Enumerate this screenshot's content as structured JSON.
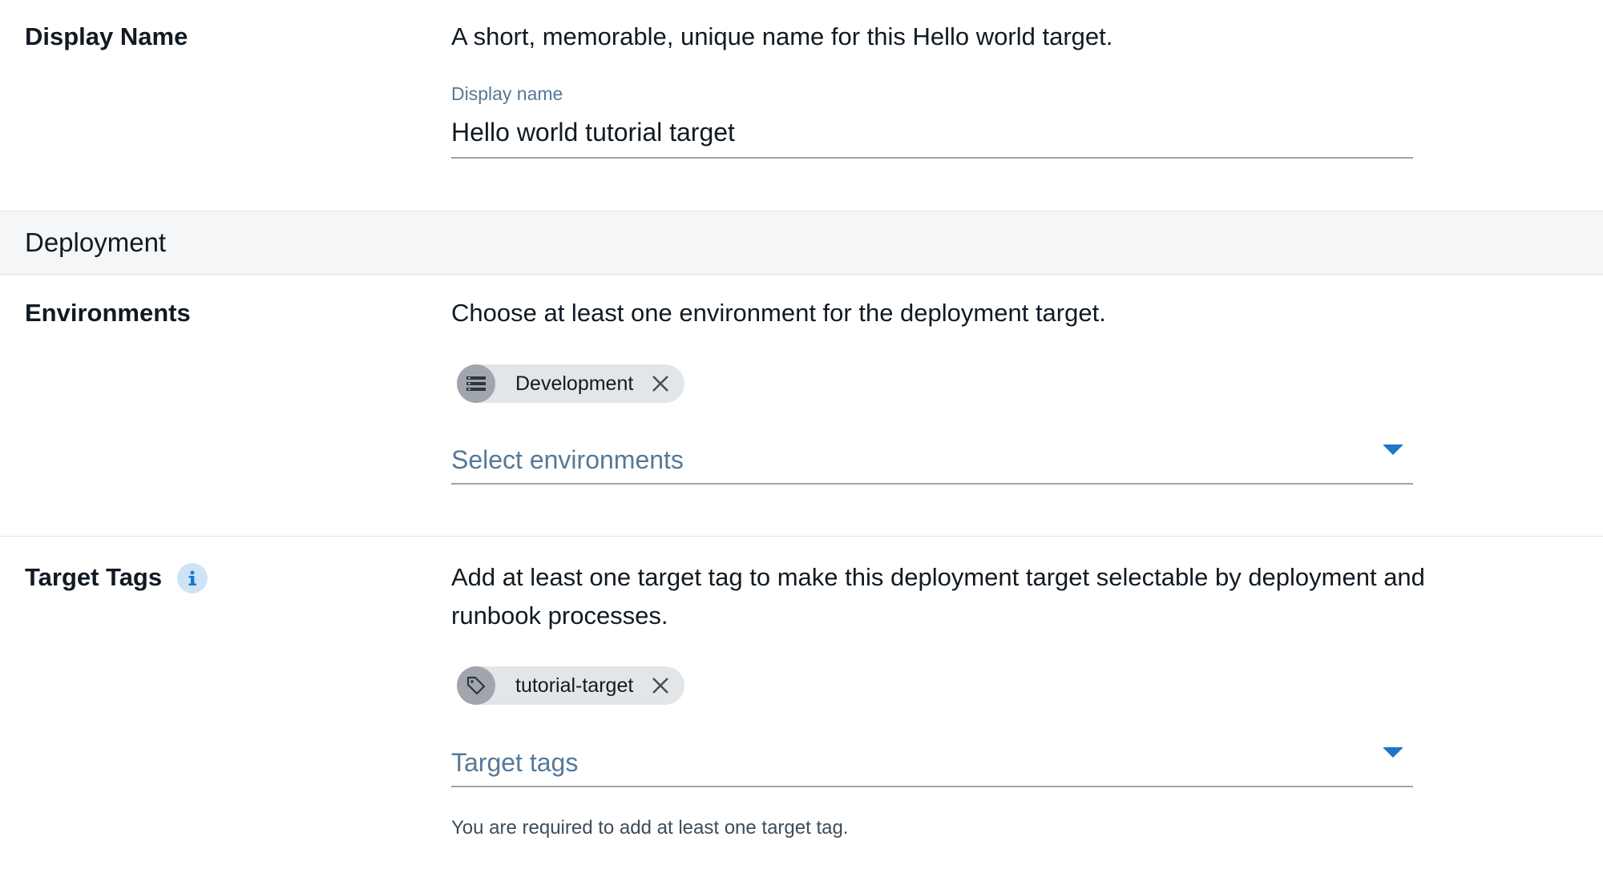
{
  "display_name_section": {
    "label": "Display Name",
    "description": "A short, memorable, unique name for this Hello world target.",
    "field_caption": "Display name",
    "field_value": "Hello world tutorial target"
  },
  "deployment_section": {
    "title": "Deployment"
  },
  "environments_section": {
    "label": "Environments",
    "description": "Choose at least one environment for the deployment target.",
    "chips": [
      {
        "label": "Development",
        "icon": "environment-icon"
      }
    ],
    "placeholder": "Select environments"
  },
  "target_tags_section": {
    "label": "Target Tags",
    "info_icon": "info-icon",
    "description": "Add at least one target tag to make this deployment target selectable by deployment and runbook processes.",
    "chips": [
      {
        "label": "tutorial-target",
        "icon": "tag-icon"
      }
    ],
    "placeholder": "Target tags",
    "helper_text": "You are required to add at least one target tag."
  },
  "colors": {
    "accent": "#1a77ca",
    "caption": "#557999",
    "band_bg": "#f5f6f7",
    "chip_bg": "#e3e6e9"
  }
}
